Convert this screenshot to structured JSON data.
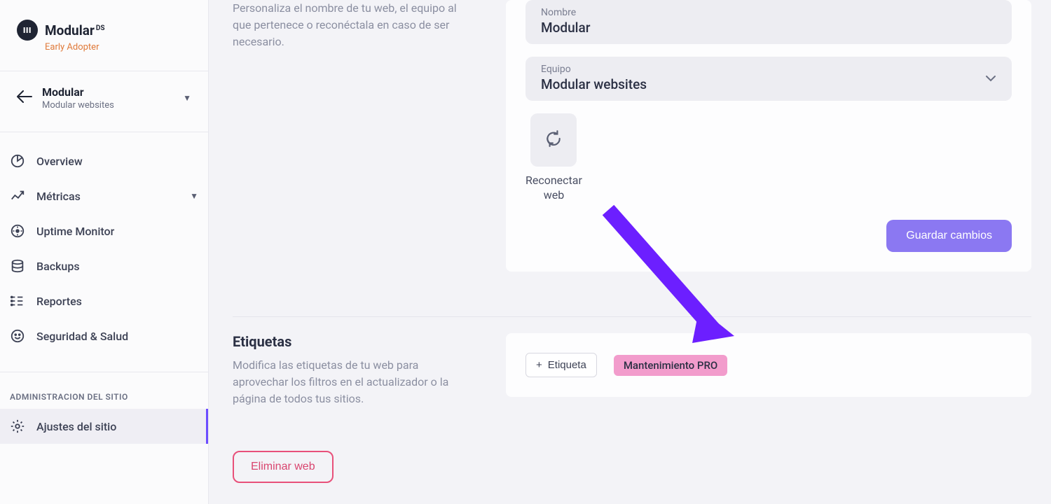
{
  "brand": {
    "name": "Modular",
    "suffix": "DS",
    "tagline": "Early Adopter"
  },
  "site_selector": {
    "site_name": "Modular",
    "team_name": "Modular websites"
  },
  "nav": {
    "items": [
      {
        "label": "Overview",
        "icon": "pie"
      },
      {
        "label": "Métricas",
        "icon": "metrics",
        "has_chevron": true
      },
      {
        "label": "Uptime Monitor",
        "icon": "uptime"
      },
      {
        "label": "Backups",
        "icon": "backups"
      },
      {
        "label": "Reportes",
        "icon": "reports"
      },
      {
        "label": "Seguridad & Salud",
        "icon": "smile"
      }
    ],
    "admin_section_header": "ADMINISTRACION DEL SITIO",
    "admin_item": {
      "label": "Ajustes del sitio",
      "icon": "gear"
    }
  },
  "intro": {
    "text": "Personaliza el nombre de tu web, el equipo al que pertenece o reconéctala en caso de ser necesario."
  },
  "form": {
    "name_label": "Nombre",
    "name_value": "Modular",
    "team_label": "Equipo",
    "team_value": "Modular websites",
    "reconnect_label": "Reconectar web",
    "save_label": "Guardar cambios"
  },
  "tags": {
    "title": "Etiquetas",
    "description": "Modifica las etiquetas de tu web para aprovechar los filtros en el actualizador o la página de todos tus sitios.",
    "add_label": "Etiqueta",
    "pill": "Mantenimiento PRO"
  },
  "actions": {
    "delete_label": "Eliminar web"
  },
  "colors": {
    "accent": "#6c4cff",
    "danger": "#d9456f",
    "tag_pink": "#f29ccc"
  }
}
